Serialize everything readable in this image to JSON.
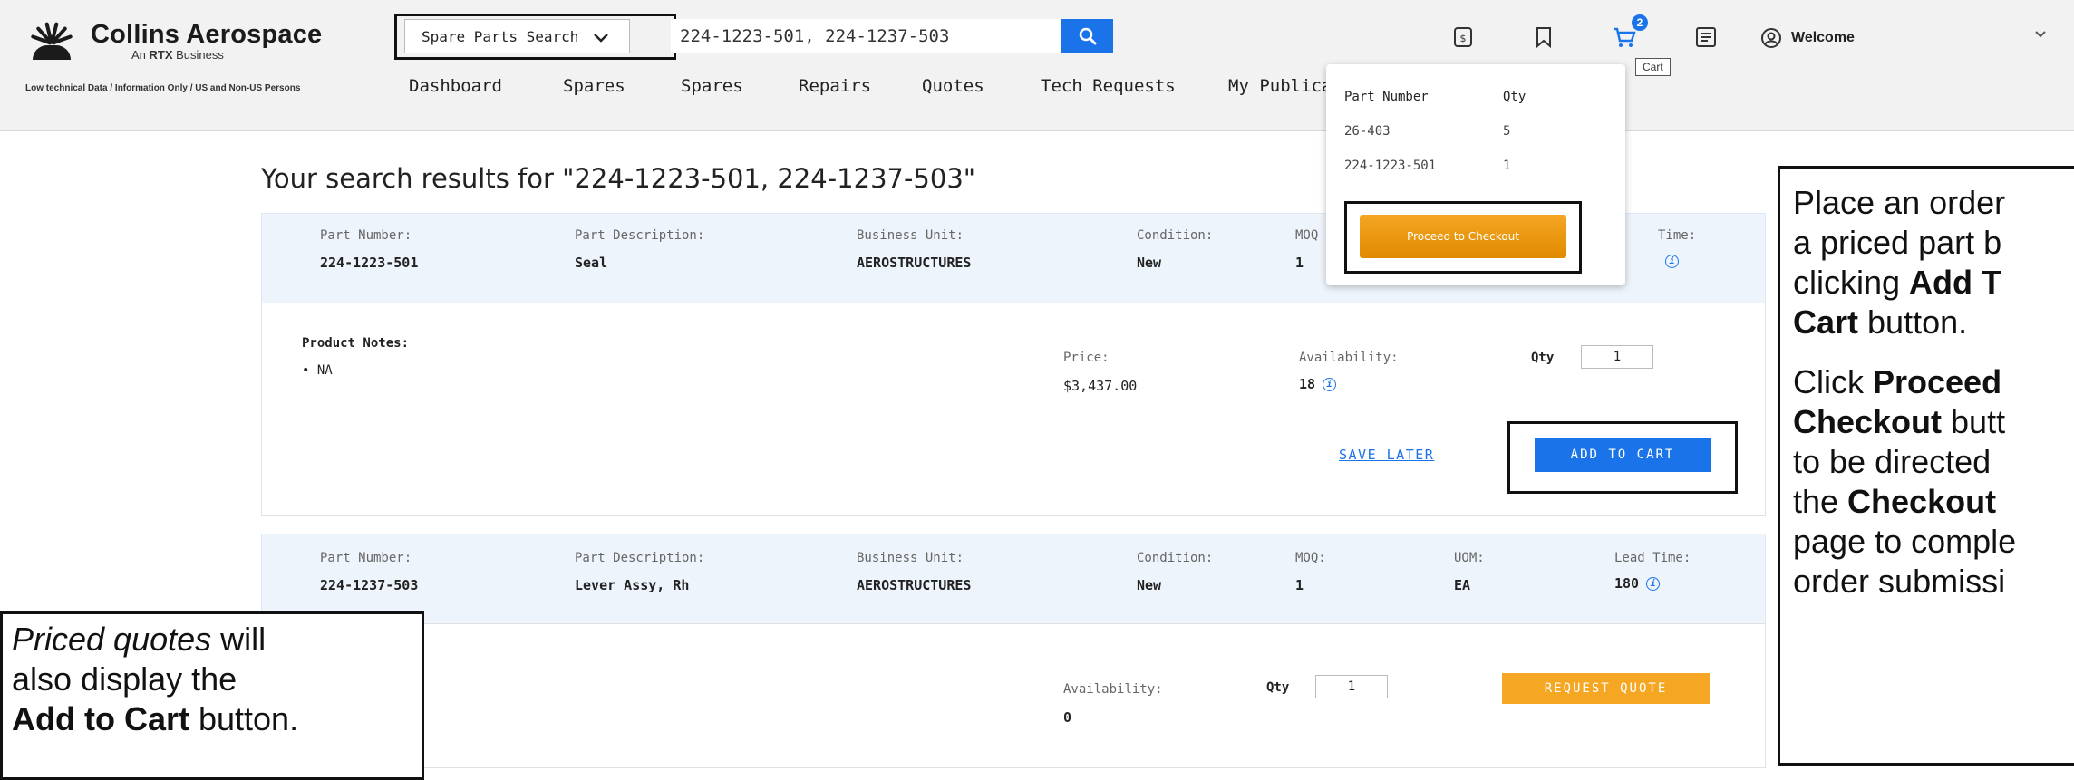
{
  "header": {
    "brand": "Collins Aerospace",
    "sub_prefix": "An ",
    "sub_bold": "RTX",
    "sub_suffix": " Business",
    "tech_note": "Low technical Data / Information Only / US and Non-US Persons",
    "search_select": "Spare Parts Search",
    "search_value": "224-1223-501, 224-1237-503",
    "cart_count": "2",
    "cart_tooltip": "Cart",
    "welcome": "Welcome",
    "icons": [
      "document-icon",
      "bookmark-icon",
      "cart-icon",
      "list-icon",
      "user-icon"
    ]
  },
  "nav": [
    "Dashboard",
    "Spares",
    "Spares",
    "Repairs",
    "Quotes",
    "Tech Requests",
    "My Publica"
  ],
  "cart_dropdown": {
    "col_part": "Part Number",
    "col_qty": "Qty",
    "items": [
      {
        "part": "26-403",
        "qty": "5"
      },
      {
        "part": "224-1223-501",
        "qty": "1"
      }
    ],
    "checkout_label": "Proceed to Checkout"
  },
  "results": {
    "title": "Your search results for \"224-1223-501, 224-1237-503\"",
    "labels": {
      "part_number": "Part Number:",
      "description": "Part Description:",
      "business_unit": "Business Unit:",
      "condition": "Condition:",
      "moq": "MOQ:",
      "moq_partial": "MOQ",
      "uom": "UOM:",
      "lead_time": "Lead Time:",
      "lead_time_partial": "Time:"
    },
    "item1": {
      "part_number": "224-1223-501",
      "description": "Seal",
      "business_unit": "AEROSTRUCTURES",
      "condition": "New",
      "moq": "1",
      "notes_title": "Product Notes:",
      "notes_item": "• NA",
      "price_label": "Price:",
      "price": "$3,437.00",
      "availability_label": "Availability:",
      "availability": "18",
      "qty_label": "Qty",
      "qty": "1",
      "save_later": "SAVE LATER",
      "add_to_cart": "ADD TO CART"
    },
    "item2": {
      "part_number": "224-1237-503",
      "description": "Lever Assy, Rh",
      "business_unit": "AEROSTRUCTURES",
      "condition": "New",
      "moq": "1",
      "uom": "EA",
      "lead_time": "180",
      "availability_label": "Availability:",
      "availability": "0",
      "qty_label": "Qty",
      "qty": "1",
      "request_quote": "REQUEST QUOTE"
    }
  },
  "callouts": {
    "right": {
      "line1": "Place an order",
      "line2": "a priced part b",
      "line3_pre": "clicking ",
      "line3_bold": "Add T",
      "line4_bold": "Cart",
      "line4_post": " button.",
      "line5_pre": "Click ",
      "line5_bold": "Proceed",
      "line6_bold": "Checkout",
      "line6_post": " butt",
      "line7": "to be directed",
      "line8_pre": "the ",
      "line8_bold": "Checkout",
      "line9": "page to comple",
      "line10": "order submissi"
    },
    "left": {
      "line1_italic": "Priced quotes",
      "line1_post": " will",
      "line2": "also display the",
      "line3_bold": "Add to Cart",
      "line3_post": " button."
    }
  }
}
